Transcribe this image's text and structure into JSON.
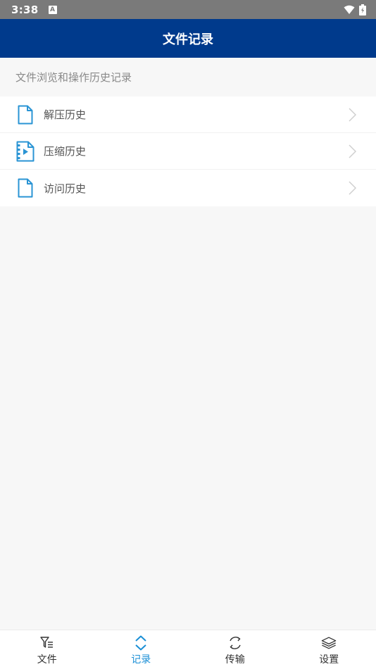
{
  "status_bar": {
    "time": "3:38",
    "notification_letter": "A"
  },
  "app_bar": {
    "title": "文件记录"
  },
  "section": {
    "header": "文件浏览和操作历史记录"
  },
  "list": {
    "items": [
      {
        "label": "解压历史",
        "icon": "document-icon"
      },
      {
        "label": "压缩历史",
        "icon": "video-file-icon"
      },
      {
        "label": "访问历史",
        "icon": "document-icon"
      }
    ]
  },
  "bottom_nav": {
    "active_index": 1,
    "items": [
      {
        "label": "文件",
        "icon": "file-filter-icon"
      },
      {
        "label": "记录",
        "icon": "expand-arrows-icon"
      },
      {
        "label": "传输",
        "icon": "sync-icon"
      },
      {
        "label": "设置",
        "icon": "layers-icon"
      }
    ]
  },
  "colors": {
    "app_bar": "#003a8c",
    "accent": "#1a8fd6",
    "status_bar": "#7a7a7a",
    "background": "#f7f7f7"
  }
}
